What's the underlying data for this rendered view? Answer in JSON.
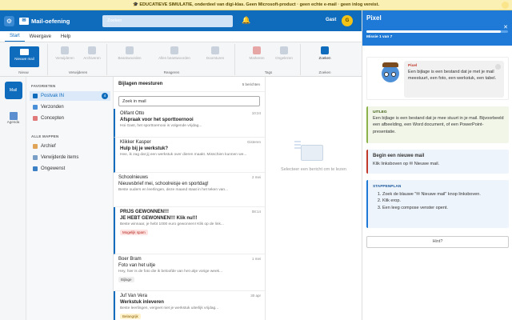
{
  "banner": {
    "text": "🎓 EDUCATIEVE SIMULATIE, onderdeel van digi-klas. Geen Microsoft-product · geen echte e-mail · geen inlog vereist."
  },
  "topbar": {
    "app_name": "Mail-oefening",
    "search_placeholder": "Zoeken",
    "user_name": "Gast",
    "avatar_initial": "G"
  },
  "tabs": [
    {
      "label": "Start"
    },
    {
      "label": "Weergave"
    },
    {
      "label": "Help"
    }
  ],
  "ribbon": {
    "new_mail": "Nieuwe mail",
    "groups": [
      "Nieuw",
      "Verwijderen",
      "Reageren",
      "Tags",
      "Zoeken"
    ],
    "buttons": {
      "delete": "Verwijderen",
      "archive": "Archiveren",
      "reply": "Beantwoorden",
      "reply_all": "Allen beantwoorden",
      "forward": "Doorsturen",
      "flag": "Markeren",
      "unread": "Ongelezen",
      "find": "Zoeken"
    }
  },
  "rail": {
    "mail": "Mail",
    "calendar": "Agenda"
  },
  "folders": {
    "favorites_label": "FAVORIETEN",
    "favorites": [
      {
        "label": "Postvak IN",
        "badge": "4"
      },
      {
        "label": "Verzonden"
      },
      {
        "label": "Concepten"
      }
    ],
    "all_label": "ALLE MAPPEN",
    "all": [
      {
        "label": "Archief"
      },
      {
        "label": "Verwijderde items"
      },
      {
        "label": "Ongewenst"
      }
    ]
  },
  "list": {
    "title": "Bijlagen meesturen",
    "count": "5 berichten",
    "search_value": "Zoek in mail",
    "mails": [
      {
        "from": "Olifant Otto",
        "time": "10:24",
        "subject": "Afspraak voor het sporttoernooi",
        "preview": "Hoi Gast, het sporttoernooi is volgende vrijdag..."
      },
      {
        "from": "Klikker Kasper",
        "time": "Gisteren",
        "subject": "Hulp bij je werkstuk?",
        "preview": "Hee, ik zag dat jij een werkstuk over dieren maakt. Misschien kunnen we..."
      },
      {
        "from": "Schoolnieuws",
        "time": "2 mei",
        "subject": "Nieuwsbrief mei, schoolreisje en sportdag!",
        "preview": "Beste ouders en leerlingen, deze maand staat in het teken van..."
      },
      {
        "from": "PRIJS GEWONNEN!!!",
        "time": "08:14",
        "subject": "JE HEBT GEWONNEN!!! Klik nu!!!",
        "preview": "Beste winnaar, je hebt 1000 euro gewonnen! Klik op de link...",
        "tag": "Mogelijk spam"
      },
      {
        "from": "Boer Bram",
        "time": "1 mei",
        "subject": "Foto van het uitje",
        "preview": "Hey, hier is de foto die ik beloofde van het uitje vorige week...",
        "tag": "Bijlage"
      },
      {
        "from": "Juf Van Vera",
        "time": "30 apr",
        "subject": "Werkstuk inleveren",
        "preview": "Beste leerlingen, vergeet niet je werkstuk uiterlijk vrijdag...",
        "tag": "Belangrijk"
      }
    ]
  },
  "reading": {
    "empty_text": "Selecteer een bericht om te lezen"
  },
  "pixel": {
    "title": "Pixel",
    "progress": 0.95,
    "step_text": "Missie 1 van 7",
    "speaker": "Pixel",
    "speech": "Een bijlage is een bestand dat je met je mail meestuurt, een foto, een werkstuk, een tabel.",
    "tip_heading": "UITLEG",
    "tip_text": "Een bijlage is een bestand dat je mee stuurt in je mail. Bijvoorbeeld een afbeelding, een Word document, of een PowerPoint-presentatie.",
    "task_heading": "Begin een nieuwe mail",
    "task_text": "Klik linksboven op ✉ Nieuwe mail.",
    "steps_heading": "STAPPENPLAN",
    "steps": [
      "Zoek de blauwe \"✉ Nieuwe mail\" knop linksboven.",
      "Klik erop.",
      "Een leeg compose venster opent."
    ],
    "hint_button": "Hint?"
  }
}
